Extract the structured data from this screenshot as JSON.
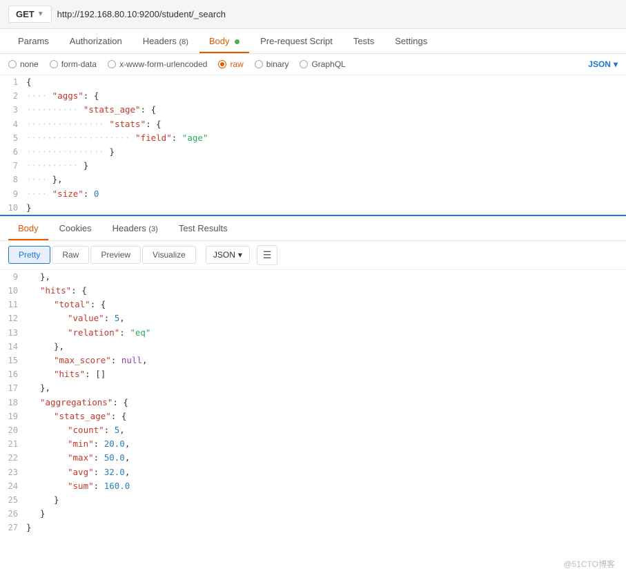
{
  "url_bar": {
    "method": "GET",
    "url": "http://192.168.80.10:9200/student/_search"
  },
  "request_tabs": [
    {
      "label": "Params",
      "active": false
    },
    {
      "label": "Authorization",
      "active": false
    },
    {
      "label": "Headers",
      "badge": "(8)",
      "active": false
    },
    {
      "label": "Body",
      "dot": true,
      "active": true
    },
    {
      "label": "Pre-request Script",
      "active": false
    },
    {
      "label": "Tests",
      "active": false
    },
    {
      "label": "Settings",
      "active": false
    }
  ],
  "body_options": [
    {
      "label": "none",
      "active": false
    },
    {
      "label": "form-data",
      "active": false
    },
    {
      "label": "x-www-form-urlencoded",
      "active": false
    },
    {
      "label": "raw",
      "active": true,
      "dot_color": "#e05a00"
    },
    {
      "label": "binary",
      "active": false
    },
    {
      "label": "GraphQL",
      "active": false
    }
  ],
  "json_dropdown_label": "JSON",
  "request_code_lines": [
    {
      "num": 1,
      "dots": "",
      "content": "{"
    },
    {
      "num": 2,
      "dots": "···",
      "content": "\"aggs\": {"
    },
    {
      "num": 3,
      "dots": "·······",
      "content": "\"stats_age\": {"
    },
    {
      "num": 4,
      "dots": "···········",
      "content": "\"stats\": {"
    },
    {
      "num": 5,
      "dots": "···············",
      "content": "\"field\": \"age\""
    },
    {
      "num": 6,
      "dots": "···········",
      "content": "}"
    },
    {
      "num": 7,
      "dots": "·······",
      "content": "}"
    },
    {
      "num": 8,
      "dots": "···",
      "content": "},"
    },
    {
      "num": 9,
      "dots": "···",
      "content": "\"size\": 0"
    },
    {
      "num": 10,
      "dots": "",
      "content": "}"
    }
  ],
  "response_tabs": [
    {
      "label": "Body",
      "active": true
    },
    {
      "label": "Cookies",
      "active": false
    },
    {
      "label": "Headers",
      "badge": "(3)",
      "active": false
    },
    {
      "label": "Test Results",
      "active": false
    }
  ],
  "format_buttons": [
    {
      "label": "Pretty",
      "active": true
    },
    {
      "label": "Raw",
      "active": false
    },
    {
      "label": "Preview",
      "active": false
    },
    {
      "label": "Visualize",
      "active": false
    }
  ],
  "response_json_label": "JSON",
  "response_code_lines": [
    {
      "num": 9,
      "content": "},",
      "type": "plain"
    },
    {
      "num": 10,
      "content": "\"hits\": {",
      "type": "key_open",
      "key": "hits"
    },
    {
      "num": 11,
      "content": "\"total\": {",
      "type": "key_open",
      "key": "total",
      "indent": 2
    },
    {
      "num": 12,
      "content": "\"value\": 5,",
      "type": "key_num",
      "key": "value",
      "val": "5",
      "indent": 3
    },
    {
      "num": 13,
      "content": "\"relation\": \"eq\"",
      "type": "key_str",
      "key": "relation",
      "val": "eq",
      "indent": 3
    },
    {
      "num": 14,
      "content": "},",
      "type": "plain",
      "indent": 2
    },
    {
      "num": 15,
      "content": "\"max_score\": null,",
      "type": "key_null",
      "key": "max_score",
      "indent": 2
    },
    {
      "num": 16,
      "content": "\"hits\": []",
      "type": "key_arr",
      "key": "hits",
      "indent": 2
    },
    {
      "num": 17,
      "content": "},",
      "type": "plain",
      "indent": 1
    },
    {
      "num": 18,
      "content": "\"aggregations\": {",
      "type": "key_open",
      "key": "aggregations",
      "indent": 1
    },
    {
      "num": 19,
      "content": "\"stats_age\": {",
      "type": "key_open",
      "key": "stats_age",
      "indent": 2
    },
    {
      "num": 20,
      "content": "\"count\": 5,",
      "type": "key_num",
      "key": "count",
      "val": "5",
      "indent": 3
    },
    {
      "num": 21,
      "content": "\"min\": 20.0,",
      "type": "key_num",
      "key": "min",
      "val": "20.0",
      "indent": 3
    },
    {
      "num": 22,
      "content": "\"max\": 50.0,",
      "type": "key_num",
      "key": "max",
      "val": "50.0",
      "indent": 3
    },
    {
      "num": 23,
      "content": "\"avg\": 32.0,",
      "type": "key_num",
      "key": "avg",
      "val": "32.0",
      "indent": 3
    },
    {
      "num": 24,
      "content": "\"sum\": 160.0",
      "type": "key_num",
      "key": "sum",
      "val": "160.0",
      "indent": 3
    },
    {
      "num": 25,
      "content": "}",
      "type": "plain",
      "indent": 2
    },
    {
      "num": 26,
      "content": "}",
      "type": "plain",
      "indent": 1
    },
    {
      "num": 27,
      "content": "}",
      "type": "plain",
      "indent": 0
    }
  ],
  "watermark": "@51CTO博客"
}
